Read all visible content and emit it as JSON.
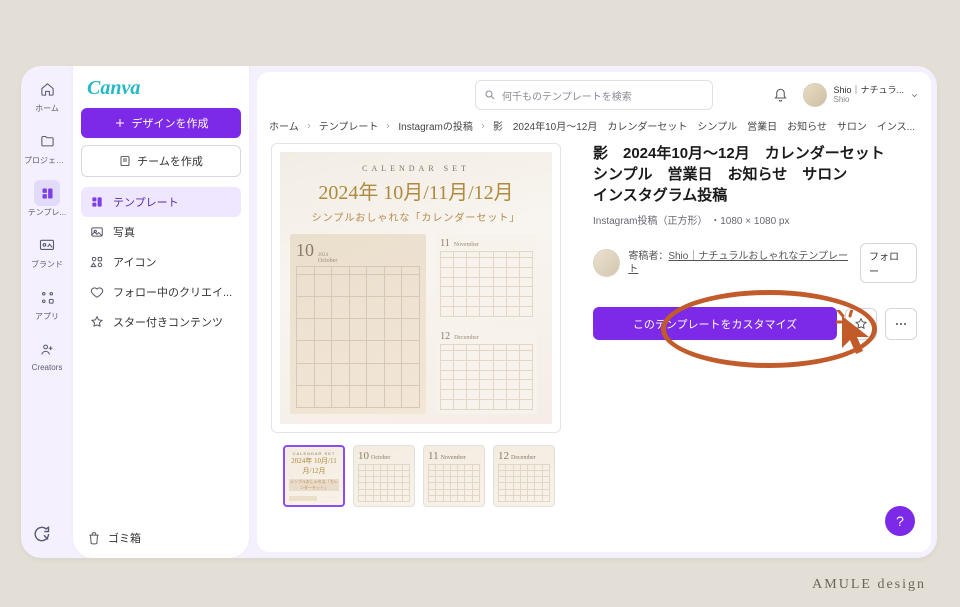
{
  "watermark": "AMULE design",
  "brand": "Canva",
  "rail": {
    "items": [
      {
        "icon": "home",
        "label": "ホーム"
      },
      {
        "icon": "folder",
        "label": "プロジェク..."
      },
      {
        "icon": "template",
        "label": "テンプレ..."
      },
      {
        "icon": "brand",
        "label": "ブランド"
      },
      {
        "icon": "apps",
        "label": "アプリ"
      },
      {
        "icon": "creators",
        "label": "Creators"
      }
    ],
    "active_index": 2
  },
  "nav": {
    "create_design": "デザインを作成",
    "create_team": "チームを作成",
    "items": [
      {
        "icon": "template",
        "label": "テンプレート"
      },
      {
        "icon": "photo",
        "label": "写真"
      },
      {
        "icon": "icon",
        "label": "アイコン"
      },
      {
        "icon": "heart",
        "label": "フォロー中のクリエイ..."
      },
      {
        "icon": "star",
        "label": "スター付きコンテンツ"
      }
    ],
    "active_index": 0,
    "trash": "ゴミ箱"
  },
  "search": {
    "placeholder": "何千ものテンプレートを検索"
  },
  "user": {
    "name": "Shio｜ナチュラ...",
    "sub": "Shio"
  },
  "breadcrumbs": [
    "ホーム",
    "テンプレート",
    "Instagramの投稿",
    "影　2024年10月～12月　カレンダーセット　シンプル　営業日　お知らせ　サロン　インス..."
  ],
  "preview": {
    "caption": "CALENDAR SET",
    "year_line": "2024年 10月/11月/12月",
    "subtitle": "シンプルおしゃれな「カレンダーセット」",
    "months": [
      {
        "num": "10",
        "en": "October"
      },
      {
        "num": "11",
        "en": "November"
      },
      {
        "num": "12",
        "en": "December"
      }
    ]
  },
  "thumbnails": [
    {
      "num": "10",
      "en": "October",
      "cover": true
    },
    {
      "num": "10",
      "en": "October"
    },
    {
      "num": "11",
      "en": "November"
    },
    {
      "num": "12",
      "en": "December"
    }
  ],
  "template": {
    "title": "影　2024年10月～12月　カレンダーセット　シンプル　営業日　お知らせ　サロン　インスタグラム投稿",
    "meta_type": "Instagram投稿（正方形）",
    "meta_size": "・1080 × 1080 px",
    "poster_prefix": "寄稿者：",
    "poster_name": "Shio｜ナチュラルおしゃれなテンプレート",
    "follow_label": "フォロー",
    "customize_label": "このテンプレートをカスタマイズ"
  },
  "fab": "?"
}
